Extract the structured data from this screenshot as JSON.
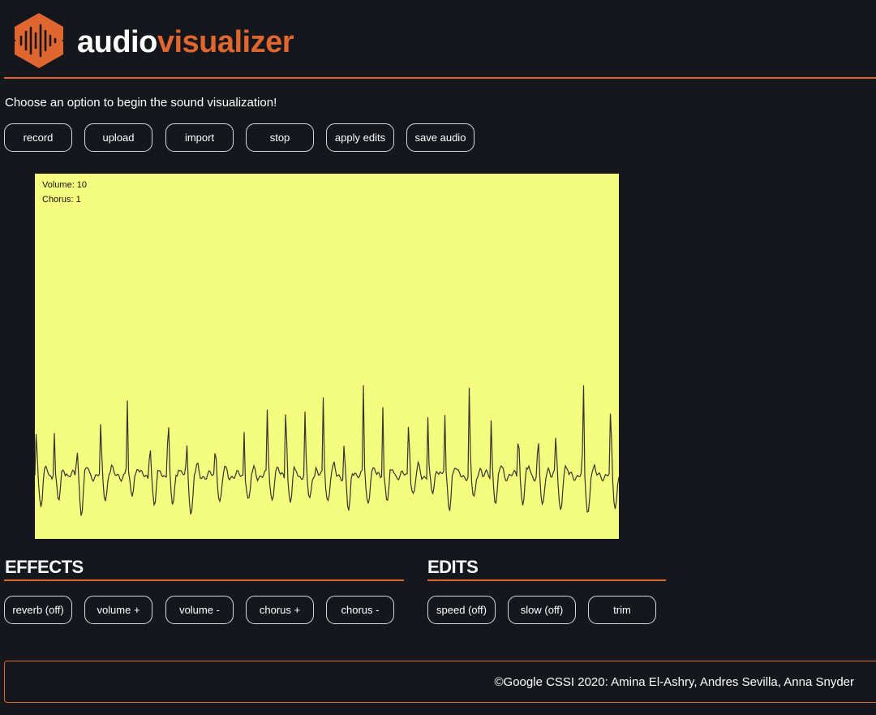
{
  "brand": {
    "part1": "audio",
    "part2": "visualizer"
  },
  "intro": "Choose an option to begin the sound visualization!",
  "controls": [
    {
      "id": "record",
      "label": "record"
    },
    {
      "id": "upload",
      "label": "upload"
    },
    {
      "id": "import",
      "label": "import"
    },
    {
      "id": "stop",
      "label": "stop"
    },
    {
      "id": "apply-edits",
      "label": "apply edits"
    },
    {
      "id": "save-audio",
      "label": "save audio"
    }
  ],
  "visualizer": {
    "volume_text": "Volume: 10",
    "chorus_text": "Chorus: 1",
    "background": "#f5fd7e",
    "waveform_color": "#333333"
  },
  "effects": {
    "title": "EFFECTS",
    "buttons": [
      {
        "id": "reverb",
        "label": "reverb (off)"
      },
      {
        "id": "volume-up",
        "label": "volume +"
      },
      {
        "id": "volume-down",
        "label": "volume -"
      },
      {
        "id": "chorus-up",
        "label": "chorus +"
      },
      {
        "id": "chorus-down",
        "label": "chorus -"
      }
    ]
  },
  "edits": {
    "title": "EDITS",
    "buttons": [
      {
        "id": "speed",
        "label": "speed (off)"
      },
      {
        "id": "slow",
        "label": "slow (off)"
      },
      {
        "id": "trim",
        "label": "trim"
      }
    ]
  },
  "footer": "©Google CSSI 2020: Amina El-Ashry, Andres Sevilla, Anna Snyder",
  "colors": {
    "accent": "#e0662f",
    "background": "#15171c"
  }
}
